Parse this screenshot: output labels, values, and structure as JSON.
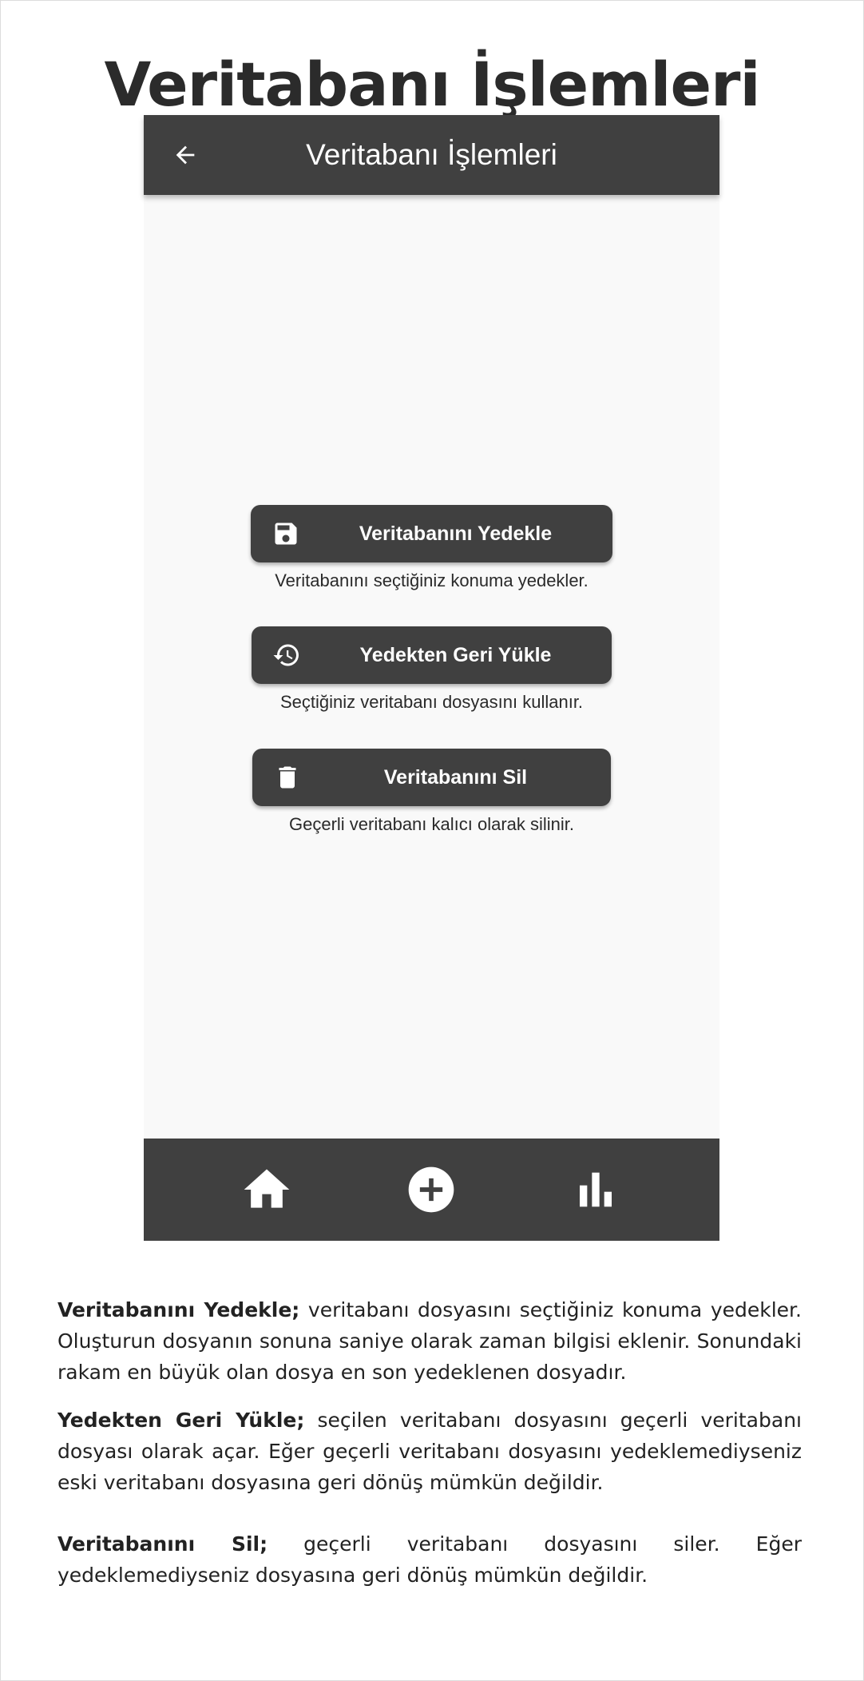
{
  "document": {
    "title": "Veritabanı İşlemleri"
  },
  "app_bar": {
    "title": "Veritabanı İşlemleri",
    "back_icon": "arrow-left-icon"
  },
  "actions": [
    {
      "label": "Veritabanını Yedekle",
      "icon": "save-icon",
      "description": "Veritabanını seçtiğiniz konuma yedekler."
    },
    {
      "label": "Yedekten Geri Yükle",
      "icon": "restore-history-icon",
      "description": "Seçtiğiniz veritabanı dosyasını kullanır."
    },
    {
      "label": "Veritabanını Sil",
      "icon": "trash-icon",
      "description": "Geçerli veritabanı kalıcı olarak silinir."
    }
  ],
  "bottom_nav": {
    "items": [
      {
        "icon": "home-icon"
      },
      {
        "icon": "add-circle-icon"
      },
      {
        "icon": "bar-chart-icon"
      }
    ]
  },
  "explanations": [
    {
      "term": "Veritabanını Yedekle;",
      "text": " veritabanı dosyasını seçtiğiniz konuma yedekler. Oluşturun dosyanın sonuna saniye olarak zaman bilgisi eklenir. Sonundaki rakam en büyük olan dosya en son yedeklenen dosyadır."
    },
    {
      "term": "Yedekten Geri Yükle;",
      "text": " seçilen veritabanı dosyasını geçerli veritabanı dosyası olarak açar. Eğer geçerli veritabanı dosyasını yedeklemediyseniz eski veritabanı dosyasına geri dönüş mümkün değildir."
    },
    {
      "term": "Veritabanını Sil;",
      "text": " geçerli veritabanı dosyasını siler. Eğer yedeklemediyseniz dosyasına geri dönüş mümkün değildir."
    }
  ],
  "colors": {
    "app_bar": "#404040",
    "screen_background": "#f9f9f9",
    "button": "#404040",
    "button_text": "#ffffff"
  }
}
